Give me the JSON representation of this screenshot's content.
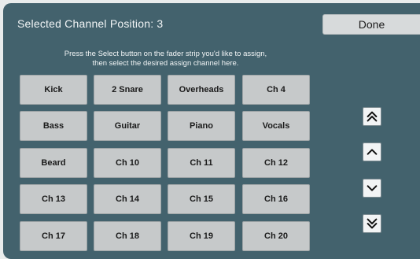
{
  "header": {
    "title": "Selected Channel Position: 3",
    "done_label": "Done"
  },
  "instructions": {
    "line1": "Press the Select button on the fader strip you'd like to assign,",
    "line2": "then select the desired assign channel here."
  },
  "channels": [
    "Kick",
    "2 Snare",
    "Overheads",
    "Ch 4",
    "Bass",
    "Guitar",
    "Piano",
    "Vocals",
    "Beard",
    "Ch 10",
    "Ch 11",
    "Ch 12",
    "Ch 13",
    "Ch 14",
    "Ch 15",
    "Ch 16",
    "Ch 17",
    "Ch 18",
    "Ch 19",
    "Ch 20"
  ],
  "nav": [
    {
      "name": "page-up-button",
      "icon": "double-chevron-up-icon"
    },
    {
      "name": "scroll-up-button",
      "icon": "chevron-up-icon"
    },
    {
      "name": "scroll-down-button",
      "icon": "chevron-down-icon"
    },
    {
      "name": "page-down-button",
      "icon": "double-chevron-down-icon"
    }
  ],
  "colors": {
    "panel": "#43626d",
    "button": "#c6c9ca",
    "done": "#d7dadb"
  }
}
